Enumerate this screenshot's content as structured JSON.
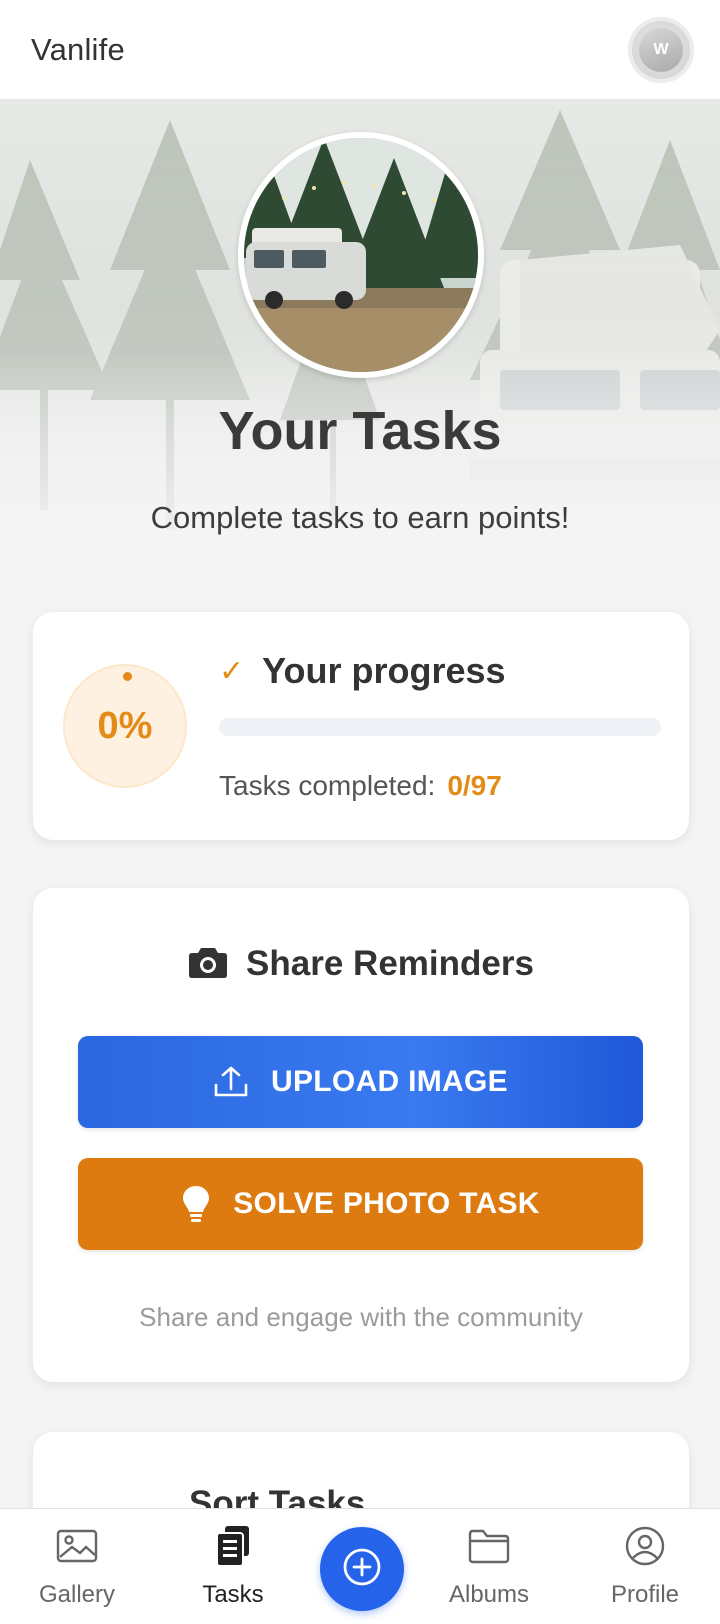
{
  "app": {
    "title": "Vanlife",
    "avatar_initial": "W"
  },
  "hero": {
    "title": "Your Tasks",
    "subtitle": "Complete tasks to earn points!"
  },
  "progress": {
    "percent_label": "0%",
    "heading": "Your progress",
    "fraction": 0,
    "tasks_label": "Tasks completed:",
    "tasks_count": "0/97",
    "accent_color": "#e48a16"
  },
  "share": {
    "heading": "Share Reminders",
    "upload_label": "UPLOAD IMAGE",
    "solve_label": "SOLVE PHOTO TASK",
    "note": "Share and engage with the community",
    "upload_color": "#2a67e0",
    "solve_color": "#dd7a10"
  },
  "sort": {
    "heading": "Sort Tasks"
  },
  "nav": {
    "items": [
      {
        "label": "Gallery",
        "icon": "image-icon"
      },
      {
        "label": "Tasks",
        "icon": "tasks-icon",
        "active": true
      },
      {
        "label": "",
        "icon": "plus-circle-icon"
      },
      {
        "label": "Albums",
        "icon": "folder-icon"
      },
      {
        "label": "Profile",
        "icon": "user-circle-icon"
      }
    ],
    "fab_color": "#2563eb"
  }
}
